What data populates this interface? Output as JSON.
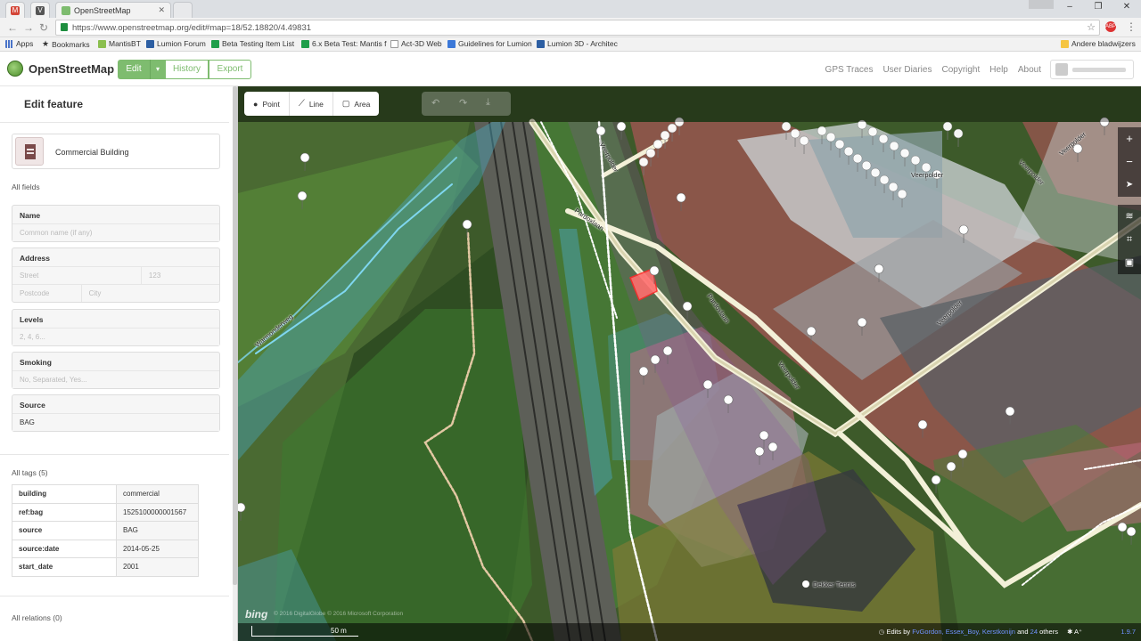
{
  "browser": {
    "tabs": [
      {
        "title": "OpenStreetMap",
        "icon": "osm-icon"
      }
    ],
    "url": "https://www.openstreetmap.org/edit#map=18/52.18820/4.49831",
    "bookmarks": [
      "Apps",
      "Bookmarks",
      "MantisBT",
      "Lumion Forum",
      "Beta Testing Item List",
      "6.x Beta Test: Mantis f",
      "Act-3D Web",
      "Guidelines for Lumion",
      "Lumion 3D - Architec"
    ],
    "other_bookmarks": "Andere bladwijzers"
  },
  "header": {
    "brand": "OpenStreetMap",
    "edit": "Edit",
    "history": "History",
    "export": "Export",
    "links": [
      "GPS Traces",
      "User Diaries",
      "Copyright",
      "Help",
      "About"
    ],
    "accent": "#7ebc6f"
  },
  "sidebar": {
    "title": "Edit feature",
    "preset": "Commercial Building",
    "all_fields": "All fields",
    "fields": {
      "name_label": "Name",
      "name_placeholder": "Common name (if any)",
      "address_label": "Address",
      "street_placeholder": "Street",
      "housenumber_placeholder": "123",
      "postcode_placeholder": "Postcode",
      "city_placeholder": "City",
      "levels_label": "Levels",
      "levels_placeholder": "2, 4, 6...",
      "smoking_label": "Smoking",
      "smoking_placeholder": "No, Separated, Yes...",
      "source_label": "Source",
      "source_value": "BAG"
    },
    "all_tags": "All tags (5)",
    "tags": [
      {
        "key": "building",
        "value": "commercial"
      },
      {
        "key": "ref:bag",
        "value": "1525100000001567"
      },
      {
        "key": "source",
        "value": "BAG"
      },
      {
        "key": "source:date",
        "value": "2014-05-25"
      },
      {
        "key": "start_date",
        "value": "2001"
      }
    ],
    "all_relations": "All relations (0)"
  },
  "map": {
    "modes": [
      "Point",
      "Line",
      "Area"
    ],
    "street_labels": [
      "Veerpolder",
      "Veerpolder",
      "Veerpolder",
      "Veerpolder",
      "Veerpolder",
      "Veerpolder",
      "Pardoxlaan",
      "Pardoxlaan",
      "Warmonderweg",
      "Dekker Tennis"
    ],
    "scale": "50 m",
    "imagery": "bing",
    "edits_prefix": "Edits by",
    "edits_users": "FvGordon, Essex_Boy, Kerstkonijn",
    "edits_and": "and",
    "edits_count": "24",
    "edits_suffix": "others",
    "version": "1.9.7"
  }
}
